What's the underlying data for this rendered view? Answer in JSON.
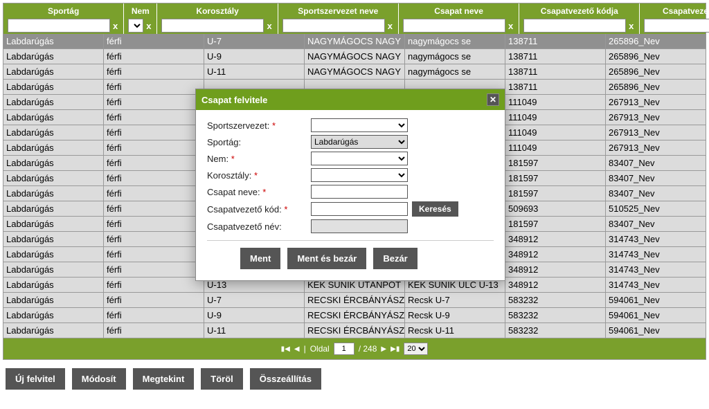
{
  "columns": [
    "Sportág",
    "Nem",
    "Korosztály",
    "Sportszervezet neve",
    "Csapat neve",
    "Csapatvezető kódja",
    "Csapatvezető neve"
  ],
  "filterTypes": [
    "text",
    "select",
    "text",
    "text",
    "text",
    "text",
    "text"
  ],
  "rows": [
    {
      "c": [
        "Labdarúgás",
        "férfi",
        "U-7",
        "NAGYMÁGOCS NAGY",
        "nagymágocs se",
        "138711",
        "265896_Nev"
      ],
      "sel": true
    },
    {
      "c": [
        "Labdarúgás",
        "férfi",
        "U-9",
        "NAGYMÁGOCS NAGY",
        "nagymágocs se",
        "138711",
        "265896_Nev"
      ]
    },
    {
      "c": [
        "Labdarúgás",
        "férfi",
        "U-11",
        "NAGYMÁGOCS NAGY",
        "nagymágocs se",
        "138711",
        "265896_Nev"
      ]
    },
    {
      "c": [
        "Labdarúgás",
        "férfi",
        "",
        "",
        "",
        "138711",
        "265896_Nev"
      ]
    },
    {
      "c": [
        "Labdarúgás",
        "férfi",
        "",
        "",
        "",
        "111049",
        "267913_Nev"
      ]
    },
    {
      "c": [
        "Labdarúgás",
        "férfi",
        "",
        "",
        "",
        "111049",
        "267913_Nev"
      ]
    },
    {
      "c": [
        "Labdarúgás",
        "férfi",
        "",
        "",
        "",
        "111049",
        "267913_Nev"
      ]
    },
    {
      "c": [
        "Labdarúgás",
        "férfi",
        "",
        "",
        "",
        "111049",
        "267913_Nev"
      ]
    },
    {
      "c": [
        "Labdarúgás",
        "férfi",
        "",
        "",
        "",
        "181597",
        "83407_Nev"
      ]
    },
    {
      "c": [
        "Labdarúgás",
        "férfi",
        "",
        "",
        "",
        "181597",
        "83407_Nev"
      ]
    },
    {
      "c": [
        "Labdarúgás",
        "férfi",
        "",
        "",
        "",
        "181597",
        "83407_Nev"
      ]
    },
    {
      "c": [
        "Labdarúgás",
        "férfi",
        "",
        "",
        "",
        "509693",
        "510525_Nev"
      ]
    },
    {
      "c": [
        "Labdarúgás",
        "férfi",
        "",
        "",
        "",
        "181597",
        "83407_Nev"
      ]
    },
    {
      "c": [
        "Labdarúgás",
        "férfi",
        "",
        "",
        "",
        "348912",
        "314743_Nev"
      ]
    },
    {
      "c": [
        "Labdarúgás",
        "férfi",
        "",
        "",
        "",
        "348912",
        "314743_Nev"
      ]
    },
    {
      "c": [
        "Labdarúgás",
        "férfi",
        "",
        "",
        "",
        "348912",
        "314743_Nev"
      ]
    },
    {
      "c": [
        "Labdarúgás",
        "férfi",
        "U-13",
        "KÉK SÜNIK UTÁNPÓT",
        "KÉK SÜNIK ULC U-13",
        "348912",
        "314743_Nev"
      ]
    },
    {
      "c": [
        "Labdarúgás",
        "férfi",
        "U-7",
        "RECSKI ÉRCBÁNYÁSZ",
        "Recsk U-7",
        "583232",
        "594061_Nev"
      ]
    },
    {
      "c": [
        "Labdarúgás",
        "férfi",
        "U-9",
        "RECSKI ÉRCBÁNYÁSZ",
        "Recsk U-9",
        "583232",
        "594061_Nev"
      ]
    },
    {
      "c": [
        "Labdarúgás",
        "férfi",
        "U-11",
        "RECSKI ÉRCBÁNYÁSZ",
        "Recsk U-11",
        "583232",
        "594061_Nev"
      ]
    }
  ],
  "pager": {
    "pageLabel": "Oldal",
    "page": "1",
    "totalLabel": "/ 248",
    "perPage": "20"
  },
  "actions": {
    "new": "Új felvitel",
    "edit": "Módosít",
    "view": "Megtekint",
    "del": "Töröl",
    "compose": "Összeállítás"
  },
  "dialog": {
    "title": "Csapat felvitele",
    "labels": {
      "org": "Sportszervezet:",
      "sport": "Sportág:",
      "gender": "Nem:",
      "age": "Korosztály:",
      "team": "Csapat neve:",
      "leadCode": "Csapatvezető kód:",
      "leadName": "Csapatvezető név:"
    },
    "sportValue": "Labdarúgás",
    "search": "Keresés",
    "buttons": {
      "save": "Ment",
      "saveClose": "Ment és bezár",
      "close": "Bezár"
    }
  }
}
